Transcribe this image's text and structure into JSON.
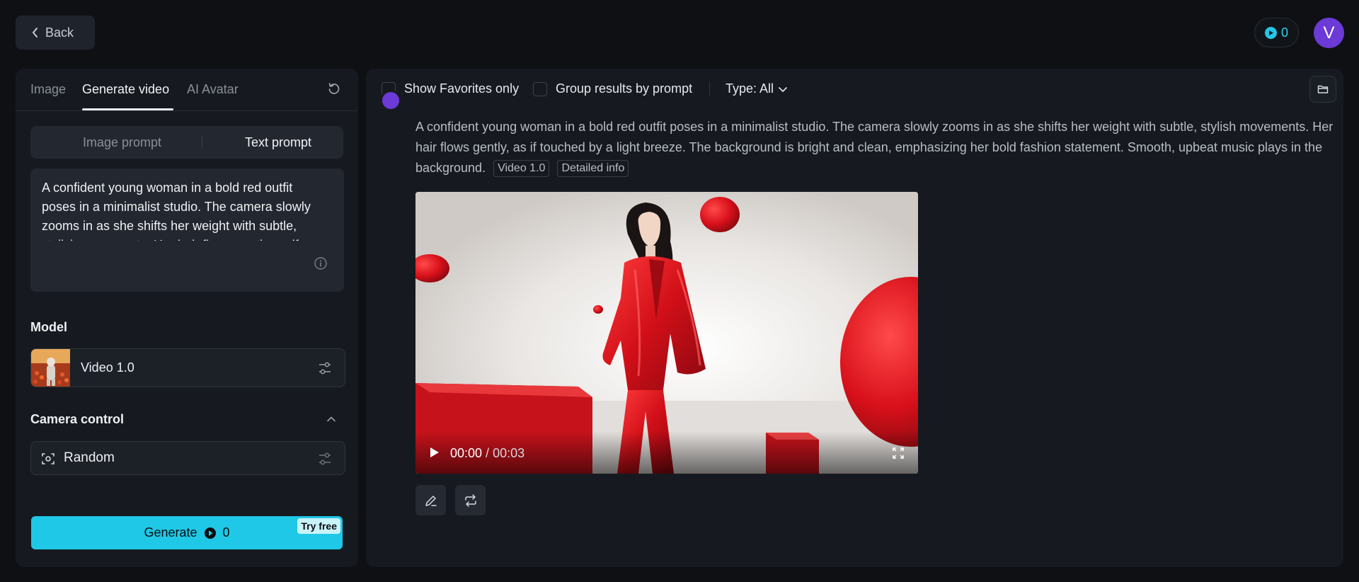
{
  "header": {
    "back_label": "Back",
    "credits": "0",
    "avatar_initial": "V"
  },
  "left_panel": {
    "tabs": [
      {
        "label": "Image",
        "active": false
      },
      {
        "label": "Generate video",
        "active": true
      },
      {
        "label": "AI Avatar",
        "active": false
      }
    ],
    "prompt_modes": [
      {
        "label": "Image prompt",
        "active": false
      },
      {
        "label": "Text prompt",
        "active": true
      }
    ],
    "prompt_text": "A confident young woman in a bold red outfit poses in a minimalist studio. The camera slowly zooms in as she shifts her weight with subtle, stylish movements. Her hair flows gently, as if touched by a light breeze. The background is bright and clean, emphasizing her bold fashion statement. Smooth, upbeat music plays in the background.",
    "model_label": "Model",
    "model_name": "Video 1.0",
    "camera_label": "Camera control",
    "camera_value": "Random",
    "generate_label": "Generate",
    "generate_cost": "0",
    "try_free_badge": "Try free"
  },
  "right_panel": {
    "filters": {
      "favorites_label": "Show Favorites only",
      "group_label": "Group results by prompt",
      "type_label": "Type: All"
    },
    "result": {
      "caption": "A confident young woman in a bold red outfit poses in a minimalist studio. The camera slowly zooms in as she shifts her weight with subtle, stylish movements. Her hair flows gently, as if touched by a light breeze. The background is bright and clean, emphasizing her bold fashion statement. Smooth, upbeat music plays in the background.",
      "model_tag": "Video 1.0",
      "info_tag": "Detailed info",
      "time_current": "00:00",
      "time_separator": " / ",
      "time_duration": "00:03"
    }
  },
  "colors": {
    "accent": "#1ec8e6",
    "avatar": "#6c3ad6",
    "background": "#0e1014",
    "panel": "#161a20"
  }
}
